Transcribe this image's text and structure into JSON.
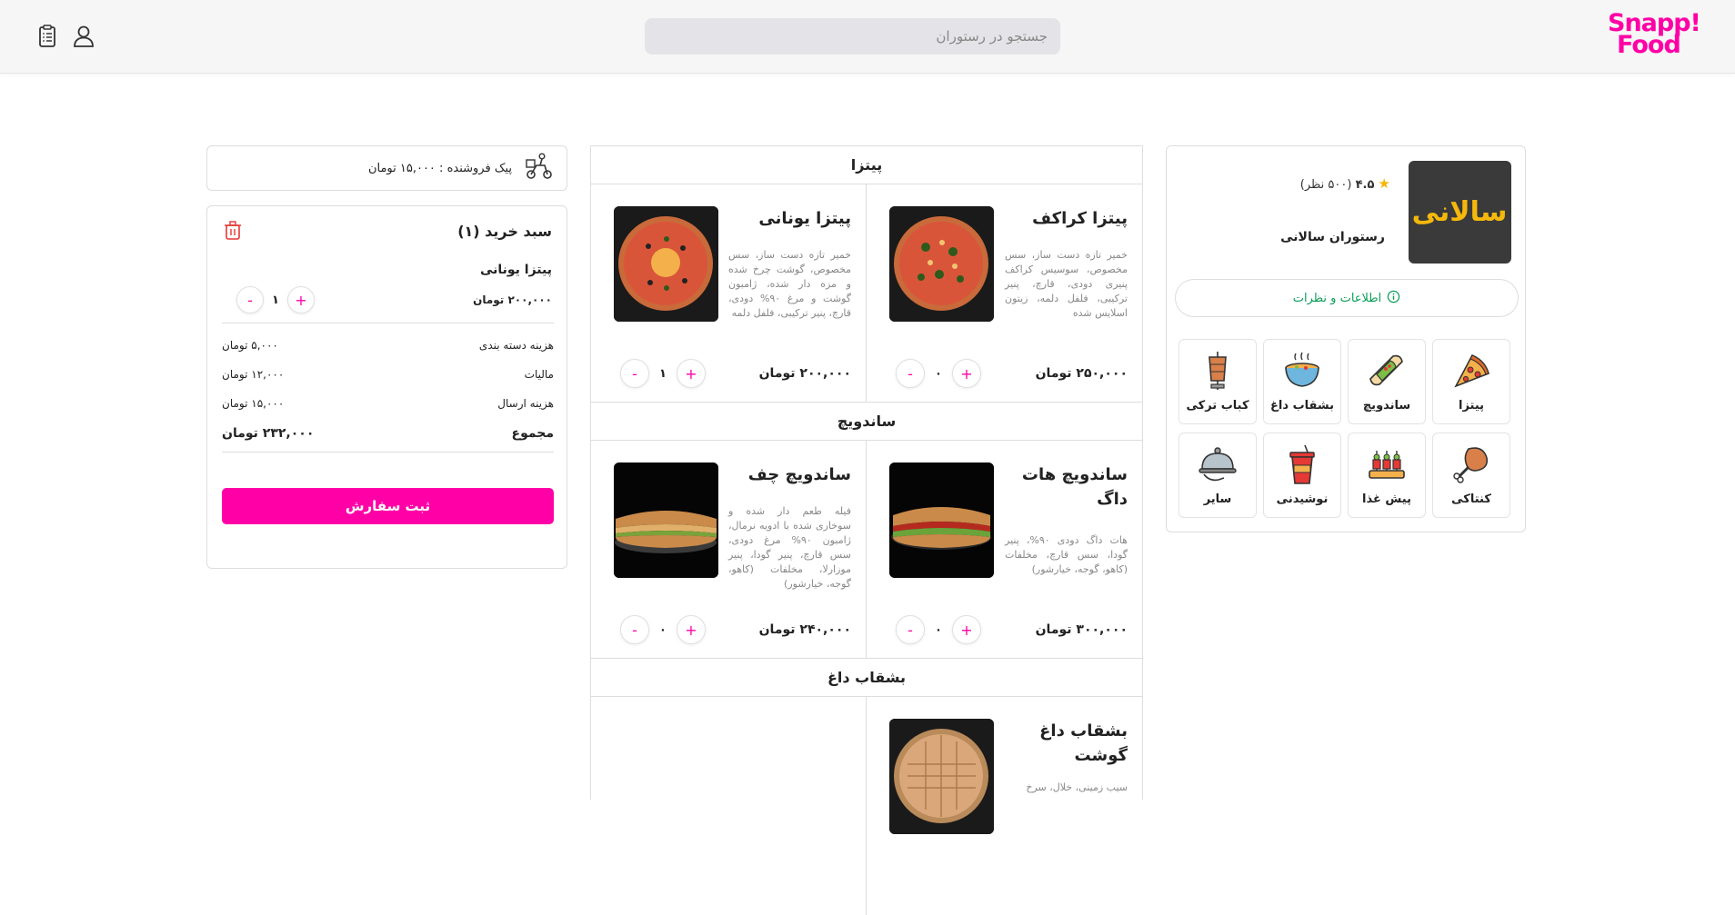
{
  "header": {
    "logo_line1": "Snapp!",
    "logo_line2": "Food",
    "search_placeholder": "جستجو در رستوران",
    "brand_color": "#ff00a6"
  },
  "restaurant": {
    "rating": "۴.۵",
    "reviews": "(۵۰۰ نظر)",
    "name": "رستوران سالانی",
    "logo_text": "سالانی",
    "info_button": "اطلاعات و نظرات",
    "categories": [
      {
        "label": "پیتزا",
        "icon": "pizza-icon"
      },
      {
        "label": "ساندویچ",
        "icon": "sandwich-icon"
      },
      {
        "label": "بشقاب داغ",
        "icon": "hot-plate-icon"
      },
      {
        "label": "کباب ترکی",
        "icon": "doner-kebab-icon"
      },
      {
        "label": "کنتاکی",
        "icon": "fried-chicken-icon"
      },
      {
        "label": "پیش غذا",
        "icon": "appetizer-icon"
      },
      {
        "label": "نوشیدنی",
        "icon": "drink-icon"
      },
      {
        "label": "سایر",
        "icon": "cloche-icon"
      }
    ]
  },
  "menu": {
    "sections": [
      {
        "title": "پیتزا",
        "items": [
          {
            "title": "پیتزا کراکف",
            "desc": "خمیر تازه دست ساز، سس مخصوص، سوسیس کراکف پنیری دودی، قارچ، پنیر ترکیبی، فلفل دلمه، زیتون اسلایس شده",
            "price": "۲۵۰,۰۰۰ تومان",
            "qty": "۰"
          },
          {
            "title": "پیتزا یونانی",
            "desc": "خمیر تازه دست ساز، سس مخصوص، گوشت چرخ شده و مزه دار شده، ژامبون گوشت و مرغ ۹۰% دودی، قارچ، پنیر ترکیبی، فلفل دلمه",
            "price": "۲۰۰,۰۰۰ تومان",
            "qty": "۱"
          }
        ]
      },
      {
        "title": "ساندویچ",
        "items": [
          {
            "title": "ساندویچ هات داگ",
            "desc": "هات داگ دودی ۹۰%، پنیر گودا، سس قارچ، مخلفات (کاهو، گوجه، خیارشور)",
            "price": "۳۰۰,۰۰۰ تومان",
            "qty": "۰"
          },
          {
            "title": "ساندویچ چف",
            "desc": "فیله طعم دار شده و سوخاری شده با ادویه نرمال، ژامبون ۹۰% مرغ دودی، سس قارچ، پنیر گودا، پنیر موزارلا، مخلفات (کاهو، گوجه، خیارشور)",
            "price": "۲۴۰,۰۰۰ تومان",
            "qty": "۰"
          }
        ]
      },
      {
        "title": "بشقاب داغ",
        "items": [
          {
            "title": "بشقاب داغ گوشت",
            "desc": "سیب زمینی، خلال، سرخ"
          }
        ]
      }
    ]
  },
  "cart": {
    "courier": "پیک فروشنده : ۱۵,۰۰۰ تومان",
    "title": "سبد خرید (۱)",
    "item_name": "پیتزا یونانی",
    "item_price": "۲۰۰,۰۰۰ تومان",
    "item_qty": "۱",
    "fees": [
      {
        "label": "هزینه دسته بندی",
        "value": "۵,۰۰۰ تومان"
      },
      {
        "label": "مالیات",
        "value": "۱۲,۰۰۰ تومان"
      },
      {
        "label": "هزینه ارسال",
        "value": "۱۵,۰۰۰ تومان"
      }
    ],
    "total_label": "مجموع",
    "total_value": "۲۳۲,۰۰۰ تومان",
    "submit": "ثبت سفارش"
  },
  "controls": {
    "plus": "+",
    "minus": "-"
  }
}
